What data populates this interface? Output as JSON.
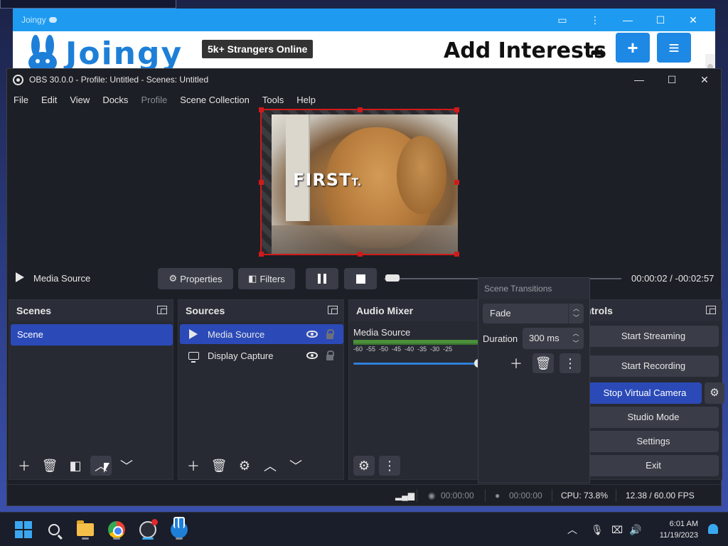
{
  "browser": {
    "title": "Joingy",
    "brand": "Joingy",
    "online_badge": "5k+ Strangers Online",
    "add_interests": "Add Interests",
    "plus_label": "+",
    "menu_label": "≡",
    "controls": [
      "▭",
      "⋮",
      "—",
      "☐",
      "✕"
    ]
  },
  "obs": {
    "title": "OBS 30.0.0 - Profile: Untitled - Scenes: Untitled",
    "win_controls": [
      "—",
      "☐",
      "✕"
    ],
    "menu": [
      {
        "label": "File"
      },
      {
        "label": "Edit"
      },
      {
        "label": "View"
      },
      {
        "label": "Docks"
      },
      {
        "label": "Profile"
      },
      {
        "label": "Scene Collection"
      },
      {
        "label": "Tools"
      },
      {
        "label": "Help"
      }
    ],
    "preview": {
      "overlay_text": "FIRST",
      "overlay_suffix": "T."
    },
    "media_bar": {
      "source_name": "Media Source",
      "properties_label": "Properties",
      "filters_label": "Filters",
      "time_elapsed": "00:00:02",
      "time_separator": "/",
      "time_remaining": "-00:02:57",
      "progress": 0.01
    },
    "docks": {
      "scenes": {
        "title": "Scenes",
        "items": [
          "Scene"
        ]
      },
      "sources": {
        "title": "Sources",
        "items": [
          {
            "label": "Media Source",
            "icon": "play-icon",
            "selected": true
          },
          {
            "label": "Display Capture",
            "icon": "monitor-icon",
            "selected": false
          }
        ]
      },
      "mixer": {
        "title": "Audio Mixer",
        "channel": "Media Source",
        "scale": [
          "-60",
          "-55",
          "-50",
          "-45",
          "-40",
          "-35",
          "-30",
          "-25"
        ],
        "volume": 1.0
      },
      "controls": {
        "title": "ntrols",
        "buttons": {
          "start_streaming": "Start Streaming",
          "start_recording": "Start Recording",
          "stop_virtual_camera": "Stop Virtual Camera",
          "studio_mode": "Studio Mode",
          "settings": "Settings",
          "exit": "Exit"
        }
      },
      "transitions": {
        "title": "Scene Transitions",
        "selected": "Fade",
        "duration_label": "Duration",
        "duration_value": "300 ms"
      }
    },
    "status": {
      "rec_time": "00:00:00",
      "stream_time": "00:00:00",
      "cpu": "CPU: 73.8%",
      "fps": "12.38 / 60.00 FPS"
    }
  },
  "taskbar": {
    "time": "6:01 AM",
    "date": "11/19/2023"
  },
  "colors": {
    "accent": "#2b4ab8",
    "record_red": "#d01a1a",
    "joingy_blue": "#1e88e5"
  }
}
